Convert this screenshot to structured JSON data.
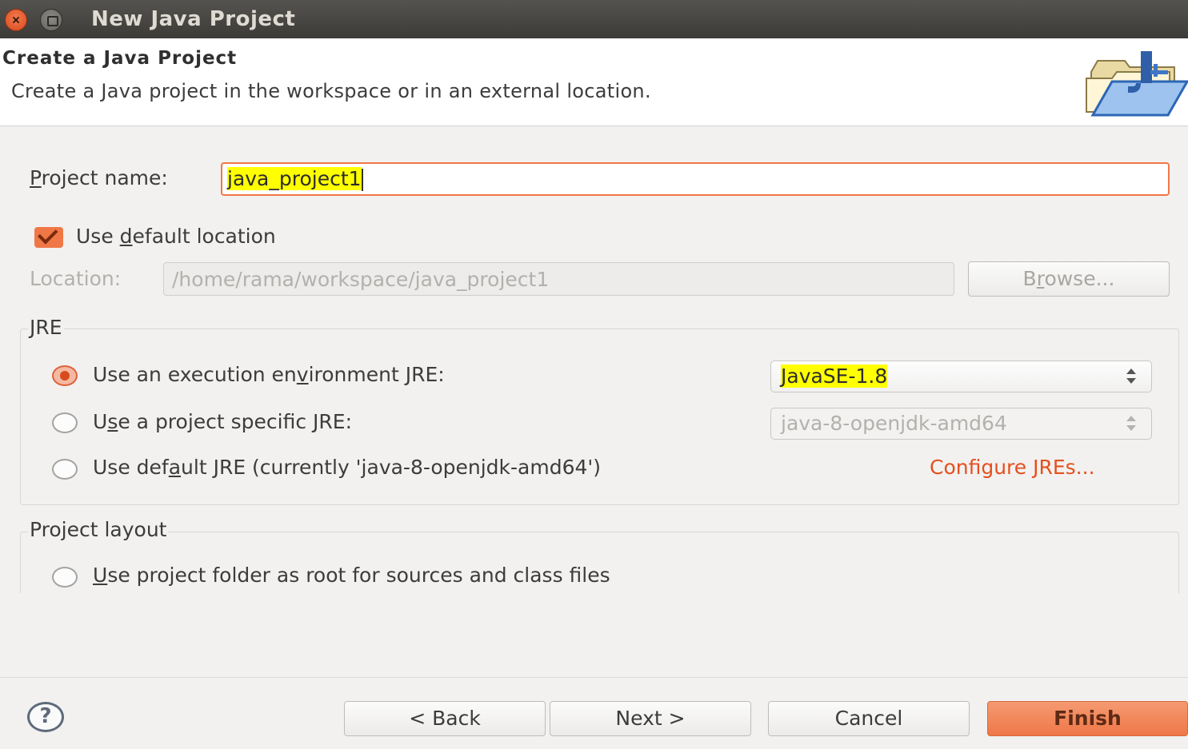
{
  "window": {
    "title": "New Java Project"
  },
  "header": {
    "title": "Create a Java Project",
    "description": "Create a Java project in the workspace or in an external location.",
    "icon": "java-project-folder-icon"
  },
  "project_name": {
    "label_pre": "",
    "label_mnemonic": "P",
    "label_post": "roject name:",
    "value": "java_project1"
  },
  "default_location": {
    "pre": "Use ",
    "mnemonic": "d",
    "post": "efault location",
    "checked": true
  },
  "location": {
    "label": "Location:",
    "value": "/home/rama/workspace/java_project1",
    "browse_pre": "B",
    "browse_mnemonic": "r",
    "browse_post": "owse..."
  },
  "jre": {
    "title": "JRE",
    "opt1_pre": "Use an execution en",
    "opt1_mn": "v",
    "opt1_post": "ironment JRE:",
    "opt1_value": "JavaSE-1.8",
    "opt2_pre": "U",
    "opt2_mn": "s",
    "opt2_post": "e a project specific JRE:",
    "opt2_value": "java-8-openjdk-amd64",
    "opt3_pre": "Use def",
    "opt3_mn": "a",
    "opt3_post": "ult JRE (currently 'java-8-openjdk-amd64')",
    "configure_link": "Configure JREs..."
  },
  "layout": {
    "title": "Project layout",
    "opt1_mn": "U",
    "opt1_post": "se project folder as root for sources and class files"
  },
  "buttons": {
    "back": "< Back",
    "next": "Next >",
    "cancel": "Cancel",
    "finish": "Finish",
    "help": "?"
  },
  "colors": {
    "accent": "#f07746",
    "link": "#e5501e",
    "highlight": "#ffff00"
  }
}
